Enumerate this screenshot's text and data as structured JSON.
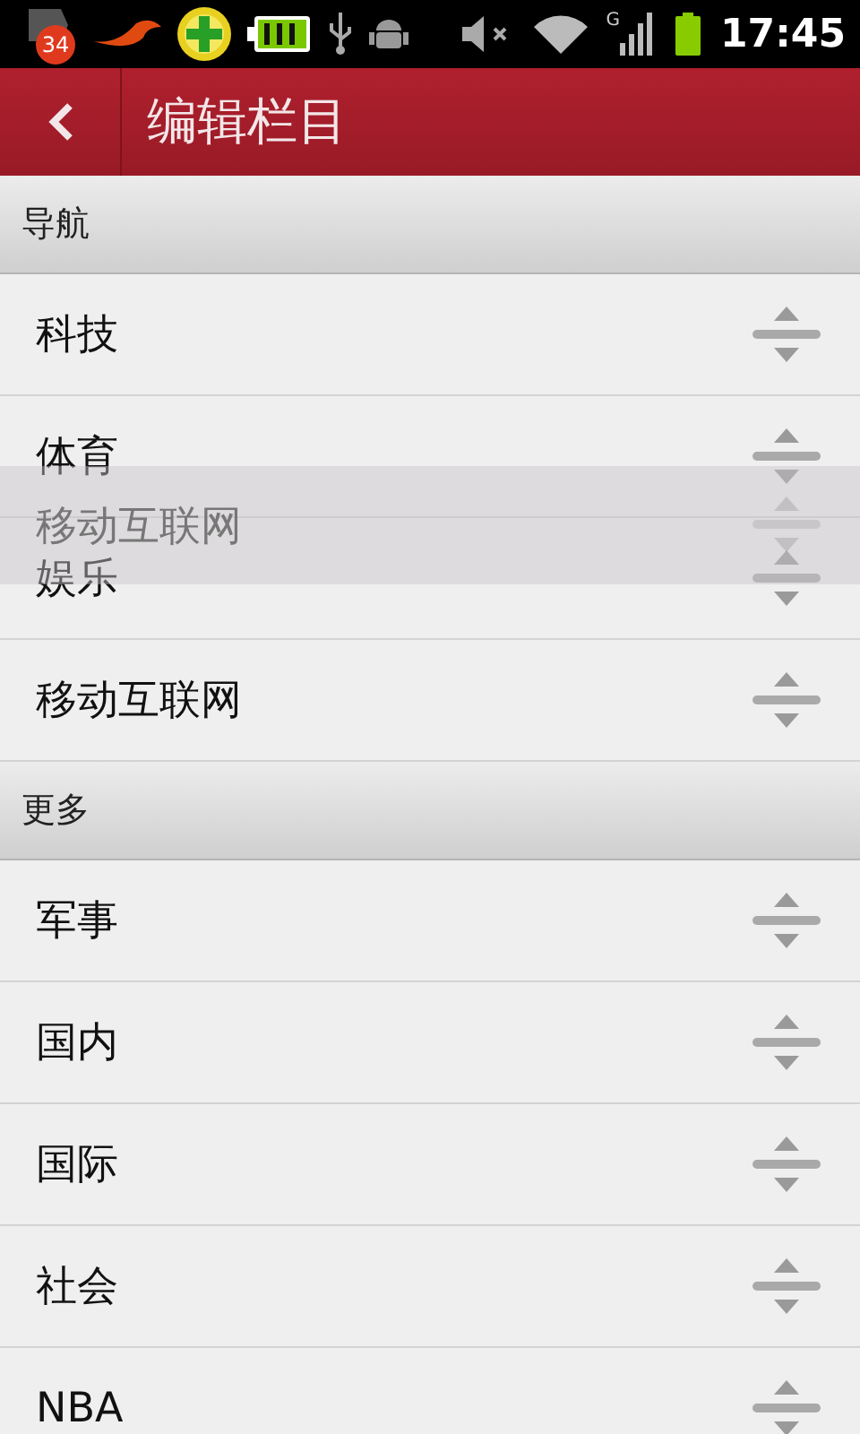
{
  "status_bar": {
    "notification_count": "34",
    "network_type": "G",
    "time": "17:45"
  },
  "title_bar": {
    "title": "编辑栏目"
  },
  "sections": [
    {
      "header": "导航",
      "rows": [
        {
          "label": "科技"
        },
        {
          "label": "体育"
        },
        {
          "label": "娱乐"
        },
        {
          "label": "移动互联网"
        }
      ]
    },
    {
      "header": "更多",
      "rows": [
        {
          "label": "军事"
        },
        {
          "label": "国内"
        },
        {
          "label": "国际"
        },
        {
          "label": "社会"
        },
        {
          "label": "NBA"
        }
      ]
    }
  ],
  "dragged_row": {
    "label": "移动互联网"
  }
}
